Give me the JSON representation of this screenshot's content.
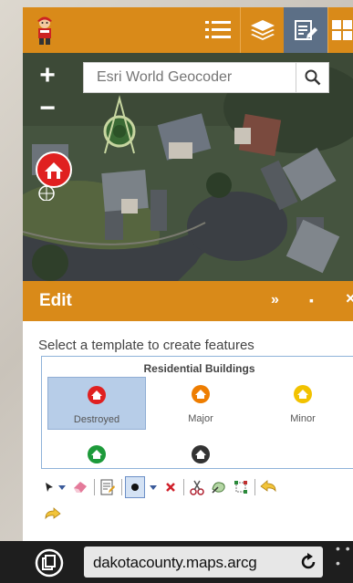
{
  "header": {
    "icons": [
      "list-icon",
      "layers-icon",
      "edit-icon",
      "grid-icon"
    ],
    "accent_color": "#d98a19",
    "active_color": "#5c6f86"
  },
  "map": {
    "zoom_in": "+",
    "zoom_out": "−",
    "search": {
      "placeholder": "Esri World Geocoder"
    }
  },
  "edit_panel": {
    "title": "Edit",
    "collapse": "»",
    "maximize": "▪",
    "close": "×",
    "prompt": "Select a template to create features",
    "group_title": "Residential Buildings",
    "templates": [
      {
        "label": "Destroyed",
        "color": "#e02020",
        "selected": true
      },
      {
        "label": "Major",
        "color": "#ee7d00",
        "selected": false
      },
      {
        "label": "Minor",
        "color": "#f2c200",
        "selected": false
      },
      {
        "label": "",
        "color": "#1d9a3a",
        "selected": false
      },
      {
        "label": "",
        "color": "#333333",
        "selected": false
      }
    ]
  },
  "browser": {
    "url": "dakotacounty.maps.arcg"
  }
}
